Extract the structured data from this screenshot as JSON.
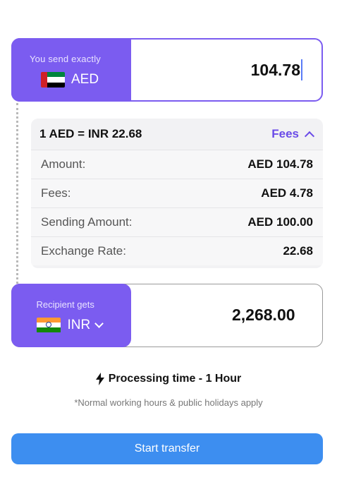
{
  "send": {
    "caption": "You send exactly",
    "currency": "AED",
    "amount": "104.78",
    "flag_icon": "uae-flag-icon"
  },
  "rate": {
    "text": "1 AED = INR 22.68",
    "fees_label": "Fees",
    "rows": [
      {
        "label": "Amount:",
        "value": "AED 104.78"
      },
      {
        "label": "Fees:",
        "value": "AED 4.78"
      },
      {
        "label": "Sending Amount:",
        "value": "AED 100.00"
      },
      {
        "label": "Exchange Rate:",
        "value": "22.68"
      }
    ]
  },
  "recipient": {
    "caption": "Recipient gets",
    "currency": "INR",
    "amount": "2,268.00",
    "flag_icon": "india-flag-icon"
  },
  "processing": {
    "text": "Processing time - 1 Hour",
    "note": "*Normal working hours & public holidays apply"
  },
  "cta": {
    "label": "Start transfer"
  },
  "colors": {
    "accent": "#7b5cf0",
    "fees_link": "#6a4be8",
    "cta": "#3d8ef0",
    "uae_green": "#00843d",
    "uae_red": "#cf2027",
    "india_saffron": "#ff9933",
    "india_green": "#138808"
  }
}
